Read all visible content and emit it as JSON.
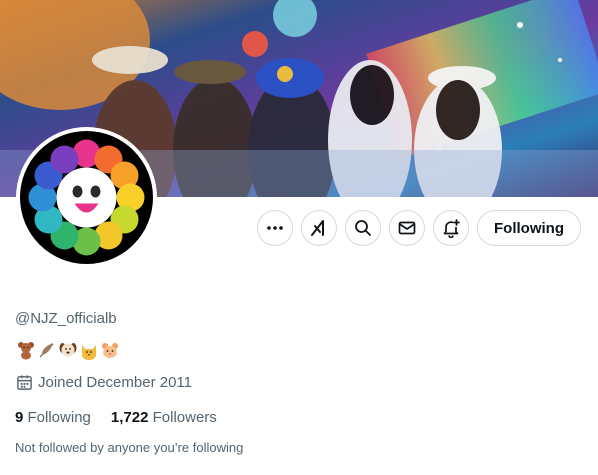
{
  "profile": {
    "handle": "@NJZ_officialb",
    "bio_emoji_names": [
      "teddy-bear",
      "feather",
      "puppy",
      "cat",
      "hamster"
    ],
    "joined": "Joined December 2011",
    "following_count": "9",
    "following_label": "Following",
    "followers_count": "1,722",
    "followers_label": "Followers",
    "mutuals_notice": "Not followed by anyone you’re following"
  },
  "actions": {
    "more_icon": "more-horizontal-icon",
    "grok_icon": "grok-icon",
    "search_icon": "search-icon",
    "message_icon": "envelope-icon",
    "notify_icon": "bell-plus-icon",
    "follow_label": "Following"
  },
  "colors": {
    "text_primary": "#0f1419",
    "text_secondary": "#536471",
    "border": "#cfd9de"
  }
}
